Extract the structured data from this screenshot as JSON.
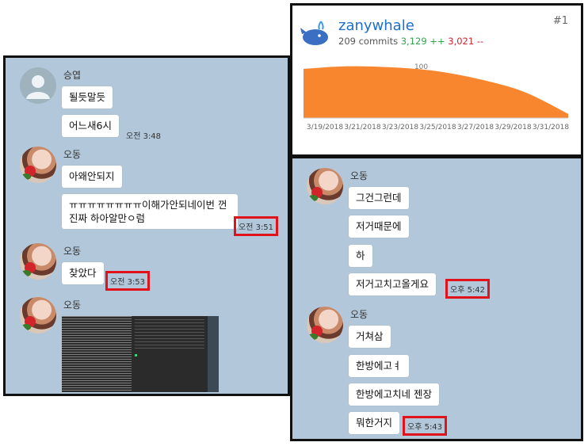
{
  "left_chat": {
    "groups": [
      {
        "sender": "승엽",
        "avatar": "default-person-icon",
        "messages": [
          "될듯말듯",
          "어느새6시"
        ],
        "time": "오전 3:48",
        "highlight": false
      },
      {
        "sender": "오동",
        "avatar": "rose-photo-avatar",
        "messages": [
          "아왜안되지",
          "ㅠㅠㅠㅠㅠㅠㅠㅠ이해가안되네이번 껀진짜 하아알만ㅇ럼"
        ],
        "time": "오전 3:51",
        "highlight": true
      },
      {
        "sender": "오동",
        "avatar": "rose-photo-avatar",
        "messages": [
          "찾았다"
        ],
        "time": "오전 3:53",
        "highlight": true
      },
      {
        "sender": "오동",
        "avatar": "rose-photo-avatar",
        "messages": [],
        "attachment": "terminal-screenshot-image"
      }
    ]
  },
  "right_chat": {
    "groups": [
      {
        "sender": "오동",
        "avatar": "rose-photo-avatar",
        "messages": [
          "그건그런데",
          "저거때문에",
          "하",
          "저거고치고올게요"
        ],
        "time": "오후 5:42",
        "highlight": true
      },
      {
        "sender": "오동",
        "avatar": "rose-photo-avatar",
        "messages": [
          "거쳐삼",
          "한방에고ㅕ",
          "한방에고치네 젠장",
          "뭐한거지"
        ],
        "time": "오후 5:43",
        "highlight": true
      }
    ]
  },
  "contributor": {
    "name": "zanywhale",
    "rank": "#1",
    "commits": "209 commits",
    "additions": "3,129 ++",
    "deletions": "3,021 --",
    "icon": "whale-icon",
    "accent_color": "#f7862f"
  },
  "chart_data": {
    "type": "area",
    "x": [
      "3/19/2018",
      "3/21/2018",
      "3/23/2018",
      "3/25/2018",
      "3/27/2018",
      "3/29/2018",
      "3/31/2018"
    ],
    "values": [
      94,
      99,
      97,
      90,
      74,
      50,
      8
    ],
    "y_ticks": [
      "100"
    ],
    "ylim": [
      0,
      100
    ],
    "color": "#f7862f",
    "grid": false
  },
  "colors": {
    "chat_bg": "#b2c7d9",
    "highlight_box": "#e0121a",
    "bubble": "#ffffff"
  }
}
